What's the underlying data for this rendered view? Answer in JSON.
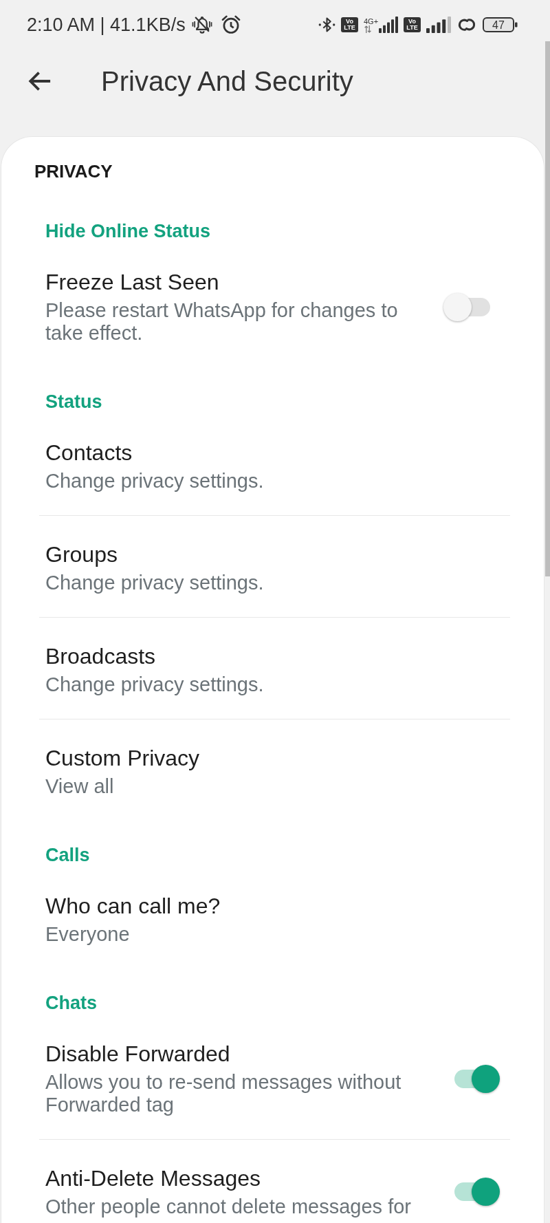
{
  "status_bar": {
    "text": "2:10 AM | 41.1KB/s",
    "sims": [
      {
        "badge": "Vo LTE",
        "network": "4G+"
      },
      {
        "badge": "Vo LTE"
      }
    ],
    "battery": "47"
  },
  "header": {
    "title": "Privacy And Security"
  },
  "section_title": "PRIVACY",
  "groups": [
    {
      "title": "Hide Online Status",
      "items": [
        {
          "kind": "toggle",
          "title": "Freeze Last Seen",
          "subtitle": "Please restart WhatsApp for changes to take effect.",
          "on": false
        }
      ]
    },
    {
      "title": "Status",
      "items": [
        {
          "kind": "link",
          "title": "Contacts",
          "subtitle": "Change privacy settings."
        },
        {
          "kind": "link",
          "title": "Groups",
          "subtitle": "Change privacy settings."
        },
        {
          "kind": "link",
          "title": "Broadcasts",
          "subtitle": "Change privacy settings."
        },
        {
          "kind": "link",
          "title": "Custom Privacy",
          "subtitle": "View all"
        }
      ]
    },
    {
      "title": "Calls",
      "items": [
        {
          "kind": "link",
          "title": "Who can call me?",
          "subtitle": "Everyone"
        }
      ]
    },
    {
      "title": "Chats",
      "items": [
        {
          "kind": "toggle",
          "title": "Disable Forwarded",
          "subtitle": "Allows you to re-send messages without Forwarded tag",
          "on": true
        },
        {
          "kind": "toggle",
          "title": "Anti-Delete Messages",
          "subtitle": "Other people cannot delete messages for",
          "on": true
        }
      ]
    }
  ]
}
